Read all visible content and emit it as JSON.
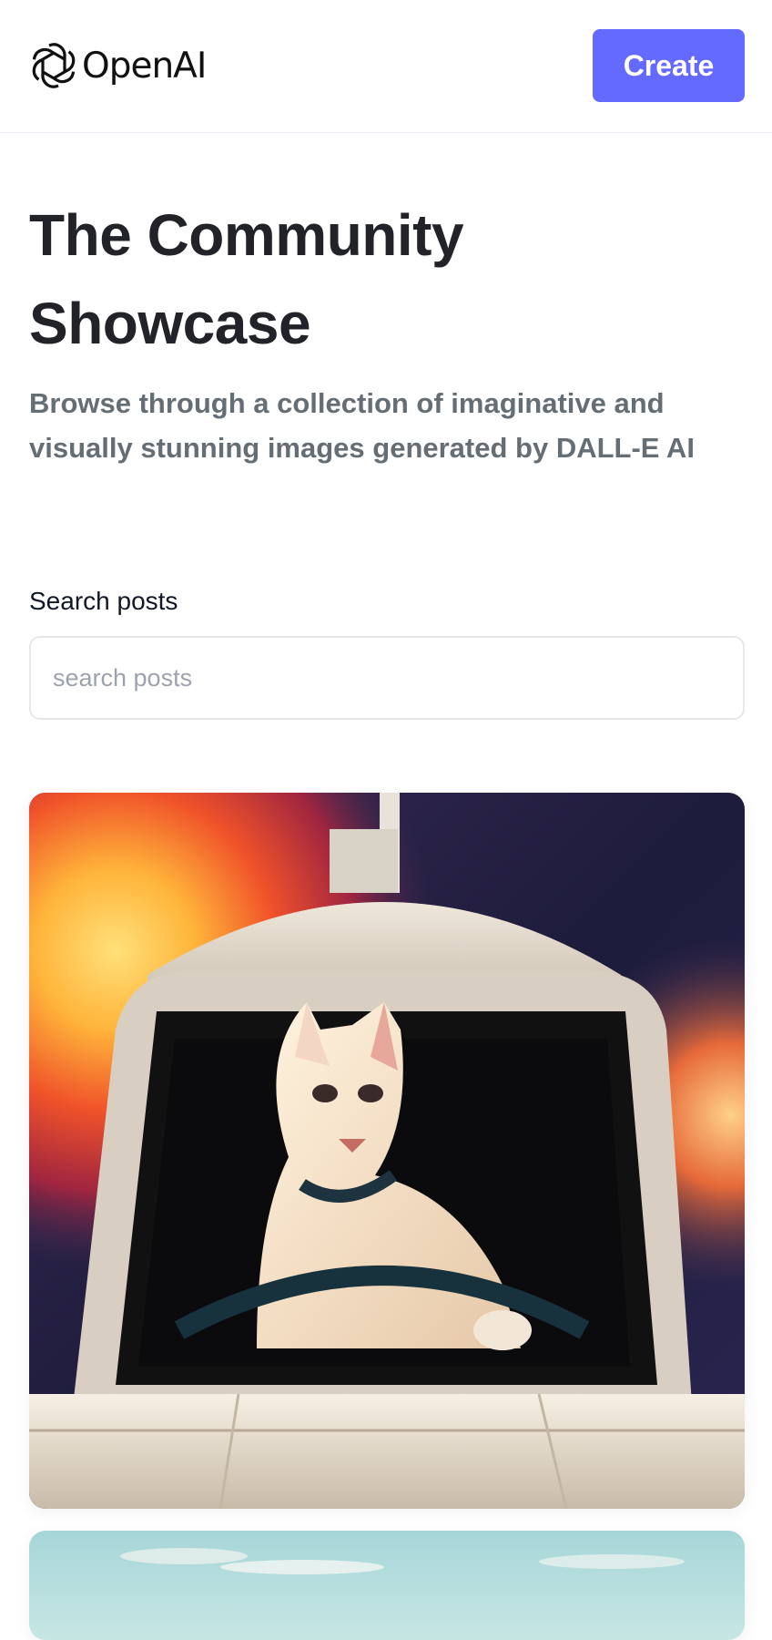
{
  "header": {
    "logo_text": "OpenAI",
    "create_label": "Create"
  },
  "hero": {
    "title": "The Community Showcase",
    "subtitle": "Browse through a collection of imaginative and visually stunning images generated by DALL-E AI"
  },
  "search": {
    "label": "Search posts",
    "placeholder": "search posts",
    "value": ""
  },
  "posts": [
    {
      "image": "cat-driving-spaceship-image"
    },
    {
      "image": "sky-landscape-image"
    }
  ],
  "colors": {
    "accent": "#6469ff",
    "title": "#222328",
    "subtitle": "#666e75",
    "border": "#e6ebf4"
  }
}
